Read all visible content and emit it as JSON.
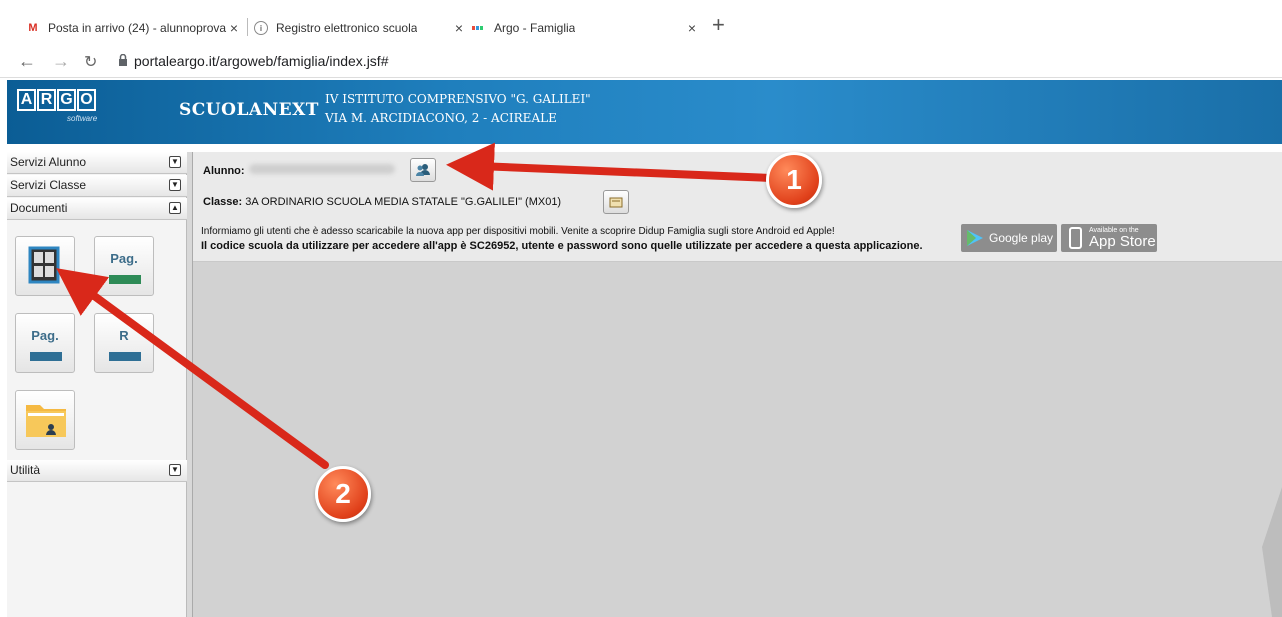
{
  "browser": {
    "tabs": [
      {
        "title": "Posta in arrivo (24) - alunnoprova",
        "icon": "gmail-icon"
      },
      {
        "title": "Registro elettronico scuola",
        "icon": "school-icon"
      },
      {
        "title": "Argo - Famiglia",
        "icon": "argo-icon"
      }
    ],
    "new_tab": "+",
    "close": "×",
    "url": "portaleargo.it/argoweb/famiglia/index.jsf#"
  },
  "header": {
    "logo_letters": [
      "A",
      "R",
      "G",
      "O"
    ],
    "logo_sub": "software",
    "brand": "SCUOLANEXT",
    "school_line1": "IV ISTITUTO COMPRENSIVO \"G. GALILEI\"",
    "school_line2": "VIA M. ARCIDIACONO, 2 - ACIREALE"
  },
  "sidebar": {
    "sections": [
      {
        "label": "Servizi Alunno",
        "state": "collapsed"
      },
      {
        "label": "Servizi Classe",
        "state": "collapsed"
      },
      {
        "label": "Documenti",
        "state": "expanded"
      },
      {
        "label": "Utilità",
        "state": "collapsed"
      }
    ],
    "tiles": [
      {
        "label": "",
        "icon": "bacheca-icon"
      },
      {
        "label": "Pag.",
        "color": "#2e8b57"
      },
      {
        "label": "Pag.",
        "color": "#2f6f95"
      },
      {
        "label": "R",
        "color": "#2f6f95"
      },
      {
        "label": "",
        "icon": "folder-user-icon"
      }
    ]
  },
  "main": {
    "alunno_label": "Alunno:",
    "classe_label": "Classe:",
    "classe_value": "3A ORDINARIO SCUOLA MEDIA STATALE \"G.GALILEI\" (MX01)",
    "info_line1": "Informiamo gli utenti che è adesso scaricabile la nuova app per dispositivi mobili. Venite a scoprire Didup Famiglia sugli store Android ed Apple!",
    "info_line2": "Il codice scuola da utilizzare per accedere all'app è SC26952, utente e password sono quelle utilizzate per accedere a questa applicazione.",
    "google_play": "Google play",
    "app_store_small": "Available on the",
    "app_store": "App Store"
  },
  "annotations": {
    "badge1": "1",
    "badge2": "2",
    "color": "#d9281a"
  }
}
